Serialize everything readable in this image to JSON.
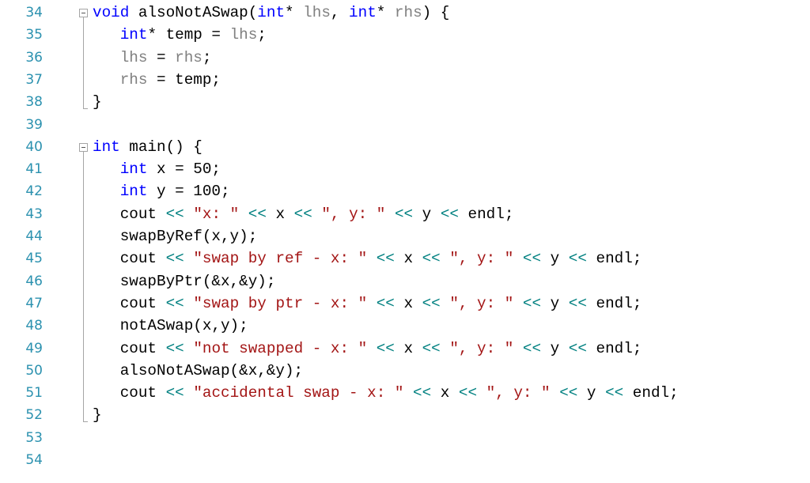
{
  "editor": {
    "colors": {
      "keyword": "#0000ff",
      "string": "#a31515",
      "operator": "#008080",
      "parameter": "#808080",
      "line_number": "#2b91af",
      "text": "#000000"
    },
    "lines": [
      {
        "number": "34",
        "tokens": [
          {
            "t": "void",
            "c": "kw"
          },
          {
            "t": " alsoNotASwap(",
            "c": "plain"
          },
          {
            "t": "int",
            "c": "kw"
          },
          {
            "t": "* ",
            "c": "plain"
          },
          {
            "t": "lhs",
            "c": "param"
          },
          {
            "t": ", ",
            "c": "plain"
          },
          {
            "t": "int",
            "c": "kw"
          },
          {
            "t": "* ",
            "c": "plain"
          },
          {
            "t": "rhs",
            "c": "param"
          },
          {
            "t": ") {",
            "c": "plain"
          }
        ]
      },
      {
        "number": "35",
        "tokens": [
          {
            "t": "   ",
            "c": "plain"
          },
          {
            "t": "int",
            "c": "kw"
          },
          {
            "t": "* temp = ",
            "c": "plain"
          },
          {
            "t": "lhs",
            "c": "param"
          },
          {
            "t": ";",
            "c": "plain"
          }
        ]
      },
      {
        "number": "36",
        "tokens": [
          {
            "t": "   ",
            "c": "plain"
          },
          {
            "t": "lhs",
            "c": "param"
          },
          {
            "t": " = ",
            "c": "plain"
          },
          {
            "t": "rhs",
            "c": "param"
          },
          {
            "t": ";",
            "c": "plain"
          }
        ]
      },
      {
        "number": "37",
        "tokens": [
          {
            "t": "   ",
            "c": "plain"
          },
          {
            "t": "rhs",
            "c": "param"
          },
          {
            "t": " = temp;",
            "c": "plain"
          }
        ]
      },
      {
        "number": "38",
        "tokens": [
          {
            "t": "}",
            "c": "plain"
          }
        ]
      },
      {
        "number": "39",
        "tokens": []
      },
      {
        "number": "40",
        "tokens": [
          {
            "t": "int",
            "c": "kw"
          },
          {
            "t": " main() {",
            "c": "plain"
          }
        ]
      },
      {
        "number": "41",
        "tokens": [
          {
            "t": "   ",
            "c": "plain"
          },
          {
            "t": "int",
            "c": "kw"
          },
          {
            "t": " x = 50;",
            "c": "plain"
          }
        ]
      },
      {
        "number": "42",
        "tokens": [
          {
            "t": "   ",
            "c": "plain"
          },
          {
            "t": "int",
            "c": "kw"
          },
          {
            "t": " y = 100;",
            "c": "plain"
          }
        ]
      },
      {
        "number": "43",
        "tokens": [
          {
            "t": "   cout ",
            "c": "plain"
          },
          {
            "t": "<<",
            "c": "op"
          },
          {
            "t": " ",
            "c": "plain"
          },
          {
            "t": "\"x: \"",
            "c": "str"
          },
          {
            "t": " ",
            "c": "plain"
          },
          {
            "t": "<<",
            "c": "op"
          },
          {
            "t": " x ",
            "c": "plain"
          },
          {
            "t": "<<",
            "c": "op"
          },
          {
            "t": " ",
            "c": "plain"
          },
          {
            "t": "\", y: \"",
            "c": "str"
          },
          {
            "t": " ",
            "c": "plain"
          },
          {
            "t": "<<",
            "c": "op"
          },
          {
            "t": " y ",
            "c": "plain"
          },
          {
            "t": "<<",
            "c": "op"
          },
          {
            "t": " endl;",
            "c": "plain"
          }
        ]
      },
      {
        "number": "44",
        "tokens": [
          {
            "t": "   swapByRef(x,y);",
            "c": "plain"
          }
        ]
      },
      {
        "number": "45",
        "tokens": [
          {
            "t": "   cout ",
            "c": "plain"
          },
          {
            "t": "<<",
            "c": "op"
          },
          {
            "t": " ",
            "c": "plain"
          },
          {
            "t": "\"swap by ref - x: \"",
            "c": "str"
          },
          {
            "t": " ",
            "c": "plain"
          },
          {
            "t": "<<",
            "c": "op"
          },
          {
            "t": " x ",
            "c": "plain"
          },
          {
            "t": "<<",
            "c": "op"
          },
          {
            "t": " ",
            "c": "plain"
          },
          {
            "t": "\", y: \"",
            "c": "str"
          },
          {
            "t": " ",
            "c": "plain"
          },
          {
            "t": "<<",
            "c": "op"
          },
          {
            "t": " y ",
            "c": "plain"
          },
          {
            "t": "<<",
            "c": "op"
          },
          {
            "t": " endl;",
            "c": "plain"
          }
        ]
      },
      {
        "number": "46",
        "tokens": [
          {
            "t": "   swapByPtr(&x,&y);",
            "c": "plain"
          }
        ]
      },
      {
        "number": "47",
        "tokens": [
          {
            "t": "   cout ",
            "c": "plain"
          },
          {
            "t": "<<",
            "c": "op"
          },
          {
            "t": " ",
            "c": "plain"
          },
          {
            "t": "\"swap by ptr - x: \"",
            "c": "str"
          },
          {
            "t": " ",
            "c": "plain"
          },
          {
            "t": "<<",
            "c": "op"
          },
          {
            "t": " x ",
            "c": "plain"
          },
          {
            "t": "<<",
            "c": "op"
          },
          {
            "t": " ",
            "c": "plain"
          },
          {
            "t": "\", y: \"",
            "c": "str"
          },
          {
            "t": " ",
            "c": "plain"
          },
          {
            "t": "<<",
            "c": "op"
          },
          {
            "t": " y ",
            "c": "plain"
          },
          {
            "t": "<<",
            "c": "op"
          },
          {
            "t": " endl;",
            "c": "plain"
          }
        ]
      },
      {
        "number": "48",
        "tokens": [
          {
            "t": "   notASwap(x,y);",
            "c": "plain"
          }
        ]
      },
      {
        "number": "49",
        "tokens": [
          {
            "t": "   cout ",
            "c": "plain"
          },
          {
            "t": "<<",
            "c": "op"
          },
          {
            "t": " ",
            "c": "plain"
          },
          {
            "t": "\"not swapped - x: \"",
            "c": "str"
          },
          {
            "t": " ",
            "c": "plain"
          },
          {
            "t": "<<",
            "c": "op"
          },
          {
            "t": " x ",
            "c": "plain"
          },
          {
            "t": "<<",
            "c": "op"
          },
          {
            "t": " ",
            "c": "plain"
          },
          {
            "t": "\", y: \"",
            "c": "str"
          },
          {
            "t": " ",
            "c": "plain"
          },
          {
            "t": "<<",
            "c": "op"
          },
          {
            "t": " y ",
            "c": "plain"
          },
          {
            "t": "<<",
            "c": "op"
          },
          {
            "t": " endl;",
            "c": "plain"
          }
        ]
      },
      {
        "number": "50",
        "tokens": [
          {
            "t": "   alsoNotASwap(&x,&y);",
            "c": "plain"
          }
        ]
      },
      {
        "number": "51",
        "tokens": [
          {
            "t": "   cout ",
            "c": "plain"
          },
          {
            "t": "<<",
            "c": "op"
          },
          {
            "t": " ",
            "c": "plain"
          },
          {
            "t": "\"accidental swap - x: \"",
            "c": "str"
          },
          {
            "t": " ",
            "c": "plain"
          },
          {
            "t": "<<",
            "c": "op"
          },
          {
            "t": " x ",
            "c": "plain"
          },
          {
            "t": "<<",
            "c": "op"
          },
          {
            "t": " ",
            "c": "plain"
          },
          {
            "t": "\", y: \"",
            "c": "str"
          },
          {
            "t": " ",
            "c": "plain"
          },
          {
            "t": "<<",
            "c": "op"
          },
          {
            "t": " y ",
            "c": "plain"
          },
          {
            "t": "<<",
            "c": "op"
          },
          {
            "t": " endl;",
            "c": "plain"
          }
        ]
      },
      {
        "number": "52",
        "tokens": [
          {
            "t": "}",
            "c": "plain"
          }
        ]
      },
      {
        "number": "53",
        "tokens": []
      },
      {
        "number": "54",
        "tokens": []
      }
    ],
    "fold_regions": [
      {
        "start_line": "34",
        "end_line": "38",
        "icon": "collapse-minus-icon"
      },
      {
        "start_line": "40",
        "end_line": "52",
        "icon": "collapse-minus-icon"
      }
    ]
  }
}
